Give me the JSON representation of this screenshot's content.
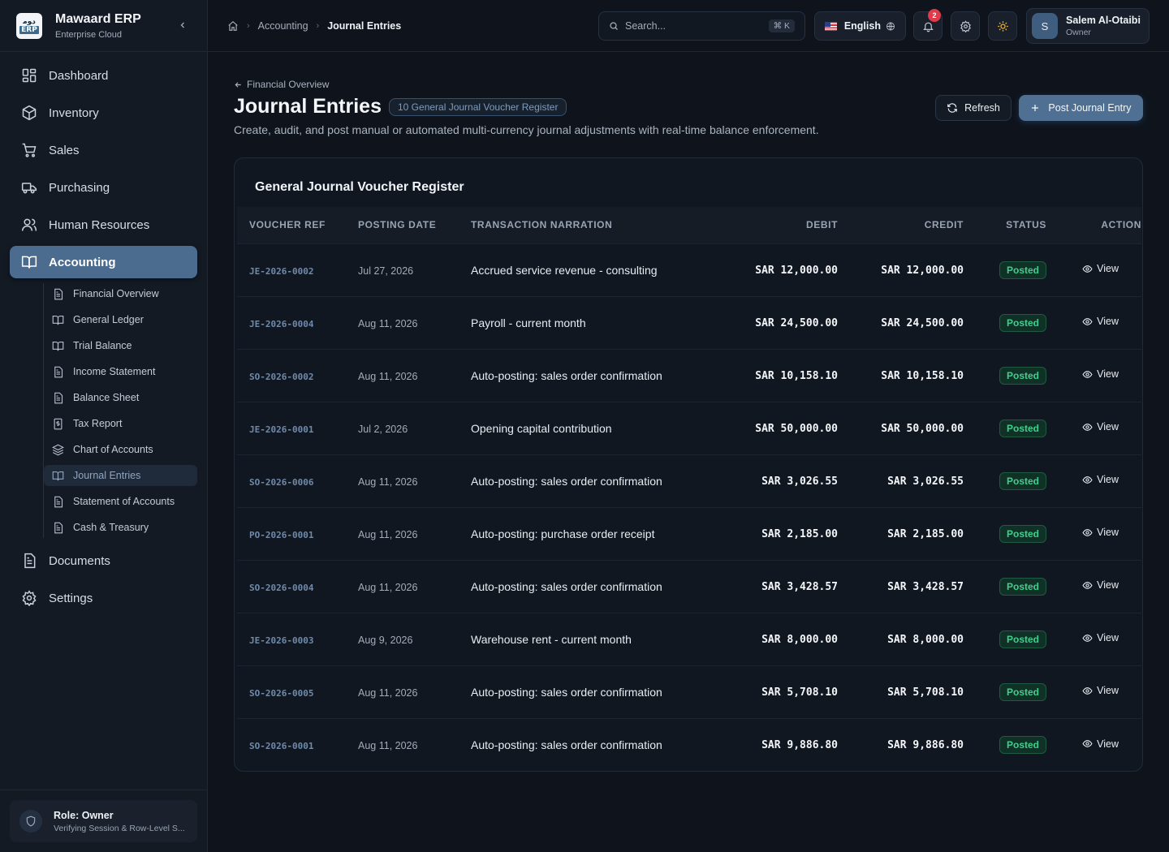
{
  "brand": {
    "logo_top": "ﺩﻮﻣ",
    "logo_bottom": "ERP",
    "name": "Mawaard ERP",
    "subtitle": "Enterprise Cloud"
  },
  "nav": {
    "dashboard": "Dashboard",
    "inventory": "Inventory",
    "sales": "Sales",
    "purchasing": "Purchasing",
    "hr": "Human Resources",
    "accounting": "Accounting",
    "documents": "Documents",
    "settings": "Settings",
    "sub": [
      "Financial Overview",
      "General Ledger",
      "Trial Balance",
      "Income Statement",
      "Balance Sheet",
      "Tax Report",
      "Chart of Accounts",
      "Journal Entries",
      "Statement of Accounts",
      "Cash & Treasury"
    ]
  },
  "role": {
    "title": "Role: Owner",
    "subtitle": "Verifying Session & Row-Level S..."
  },
  "breadcrumb": {
    "section": "Accounting",
    "current": "Journal Entries"
  },
  "search": {
    "placeholder": "Search...",
    "shortcut": "⌘ K"
  },
  "language": "English",
  "notifications": {
    "count": "2"
  },
  "user": {
    "initial": "S",
    "name": "Salem Al-Otaibi",
    "role": "Owner"
  },
  "page": {
    "back": "Financial Overview",
    "title": "Journal Entries",
    "pill": "10 General Journal Voucher Register",
    "description": "Create, audit, and post manual or automated multi-currency journal adjustments with real-time balance enforcement.",
    "refresh": "Refresh",
    "post": "Post Journal Entry"
  },
  "table": {
    "title": "General Journal Voucher Register",
    "columns": {
      "ref": "VOUCHER REF",
      "date": "POSTING DATE",
      "narration": "TRANSACTION NARRATION",
      "debit": "DEBIT",
      "credit": "CREDIT",
      "status": "STATUS",
      "action": "ACTION"
    },
    "action_label": "View",
    "rows": [
      {
        "ref": "JE-2026-0002",
        "date": "Jul 27, 2026",
        "narration": "Accrued service revenue - consulting",
        "debit": "SAR 12,000.00",
        "credit": "SAR 12,000.00",
        "status": "Posted"
      },
      {
        "ref": "JE-2026-0004",
        "date": "Aug 11, 2026",
        "narration": "Payroll - current month",
        "debit": "SAR 24,500.00",
        "credit": "SAR 24,500.00",
        "status": "Posted"
      },
      {
        "ref": "SO-2026-0002",
        "date": "Aug 11, 2026",
        "narration": "Auto-posting: sales order confirmation",
        "debit": "SAR 10,158.10",
        "credit": "SAR 10,158.10",
        "status": "Posted"
      },
      {
        "ref": "JE-2026-0001",
        "date": "Jul 2, 2026",
        "narration": "Opening capital contribution",
        "debit": "SAR 50,000.00",
        "credit": "SAR 50,000.00",
        "status": "Posted"
      },
      {
        "ref": "SO-2026-0006",
        "date": "Aug 11, 2026",
        "narration": "Auto-posting: sales order confirmation",
        "debit": "SAR 3,026.55",
        "credit": "SAR 3,026.55",
        "status": "Posted"
      },
      {
        "ref": "PO-2026-0001",
        "date": "Aug 11, 2026",
        "narration": "Auto-posting: purchase order receipt",
        "debit": "SAR 2,185.00",
        "credit": "SAR 2,185.00",
        "status": "Posted"
      },
      {
        "ref": "SO-2026-0004",
        "date": "Aug 11, 2026",
        "narration": "Auto-posting: sales order confirmation",
        "debit": "SAR 3,428.57",
        "credit": "SAR 3,428.57",
        "status": "Posted"
      },
      {
        "ref": "JE-2026-0003",
        "date": "Aug 9, 2026",
        "narration": "Warehouse rent - current month",
        "debit": "SAR 8,000.00",
        "credit": "SAR 8,000.00",
        "status": "Posted"
      },
      {
        "ref": "SO-2026-0005",
        "date": "Aug 11, 2026",
        "narration": "Auto-posting: sales order confirmation",
        "debit": "SAR 5,708.10",
        "credit": "SAR 5,708.10",
        "status": "Posted"
      },
      {
        "ref": "SO-2026-0001",
        "date": "Aug 11, 2026",
        "narration": "Auto-posting: sales order confirmation",
        "debit": "SAR 9,886.80",
        "credit": "SAR 9,886.80",
        "status": "Posted"
      }
    ]
  }
}
